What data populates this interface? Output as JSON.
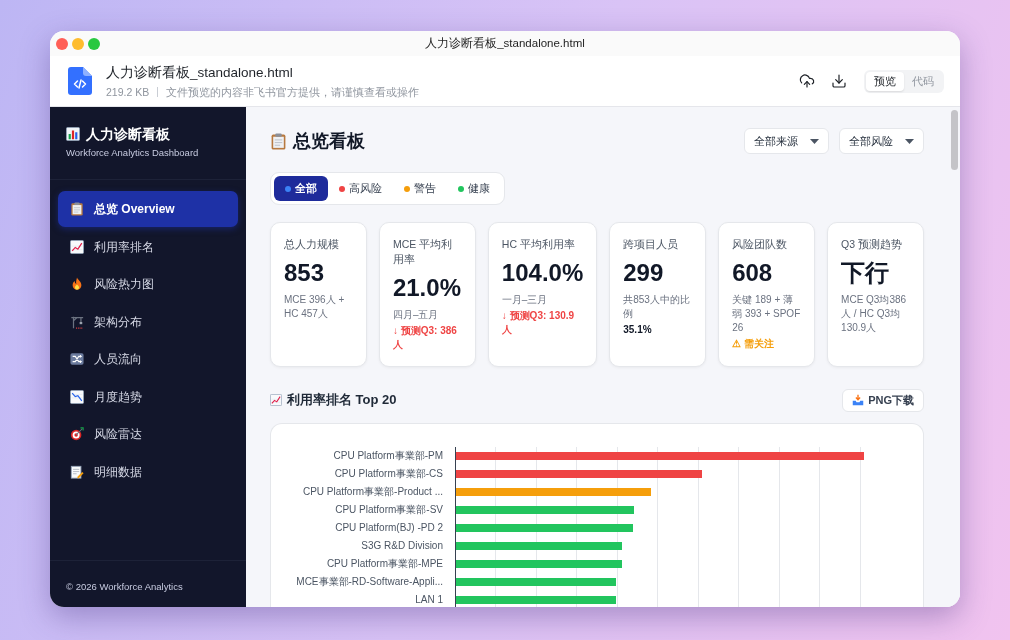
{
  "window": {
    "title": "人力诊断看板_standalone.html"
  },
  "file_header": {
    "name": "人力诊断看板_standalone.html",
    "size": "219.2 KB",
    "notice": "文件预览的内容非飞书官方提供，请谨慎查看或操作",
    "view_tabs": [
      {
        "label": "预览",
        "selected": true
      },
      {
        "label": "代码",
        "selected": false
      }
    ]
  },
  "sidebar": {
    "title": "人力诊断看板",
    "subtitle": "Workforce Analytics Dashboard",
    "items": [
      {
        "label": "总览 Overview",
        "selected": true
      },
      {
        "label": "利用率排名",
        "selected": false
      },
      {
        "label": "风险热力图",
        "selected": false
      },
      {
        "label": "架构分布",
        "selected": false
      },
      {
        "label": "人员流向",
        "selected": false
      },
      {
        "label": "月度趋势",
        "selected": false
      },
      {
        "label": "风险雷达",
        "selected": false
      },
      {
        "label": "明细数据",
        "selected": false
      }
    ],
    "footer": "© 2026 Workforce Analytics"
  },
  "main": {
    "title": "总览看板",
    "filters": [
      {
        "value": "全部来源"
      },
      {
        "value": "全部风险"
      }
    ],
    "risk_tabs": [
      {
        "label": "全部",
        "selected": true,
        "color": "#3b82f6"
      },
      {
        "label": "高风险",
        "selected": false,
        "color": "#ef4444"
      },
      {
        "label": "警告",
        "selected": false,
        "color": "#f59e0b"
      },
      {
        "label": "健康",
        "selected": false,
        "color": "#22c55e"
      }
    ],
    "cards": [
      {
        "title": "总人力规模",
        "value": "853",
        "lines": [
          {
            "kind": "note",
            "text": "MCE 396人 + HC 457人"
          }
        ]
      },
      {
        "title": "MCE 平均利用率",
        "value": "21.0%",
        "lines": [
          {
            "kind": "note",
            "text": "四月–五月"
          },
          {
            "kind": "trend",
            "text": "↓ 预测Q3: 386人"
          }
        ]
      },
      {
        "title": "HC 平均利用率",
        "value": "104.0%",
        "lines": [
          {
            "kind": "note",
            "text": "一月–三月"
          },
          {
            "kind": "trend",
            "text": "↓ 预测Q3: 130.9人"
          }
        ]
      },
      {
        "title": "跨项目人员",
        "value": "299",
        "lines": [
          {
            "kind": "note",
            "text": "共853人中的比例"
          },
          {
            "kind": "figure",
            "text": "35.1%"
          }
        ]
      },
      {
        "title": "风险团队数",
        "value": "608",
        "lines": [
          {
            "kind": "note",
            "text": "关键 189 + 薄弱 393 + SPOF 26"
          },
          {
            "kind": "alert",
            "text": "⚠ 需关注"
          }
        ]
      },
      {
        "title": "Q3 预测趋势",
        "value": "下行",
        "lines": [
          {
            "kind": "note",
            "text": "MCE Q3均386人 / HC Q3均130.9人"
          }
        ]
      }
    ],
    "ranking": {
      "title": "利用率排名 Top 20",
      "download_button": "PNG下载",
      "bars": [
        {
          "label": "CPU Platform事業部-PM",
          "color": "#ef4444",
          "level": 0.92
        },
        {
          "label": "CPU Platform事業部-CS",
          "color": "#ef4444",
          "level": 0.555
        },
        {
          "label": "CPU Platform事業部-Product ...",
          "color": "#f59e0b",
          "level": 0.44
        },
        {
          "label": "CPU Platform事業部-SV",
          "color": "#22c55e",
          "level": 0.402
        },
        {
          "label": "CPU Platform(BJ) -PD 2",
          "color": "#22c55e",
          "level": 0.398
        },
        {
          "label": "S3G R&D Division",
          "color": "#22c55e",
          "level": 0.374
        },
        {
          "label": "CPU Platform事業部-MPE",
          "color": "#22c55e",
          "level": 0.373
        },
        {
          "label": "MCE事業部-RD-Software-Appli...",
          "color": "#22c55e",
          "level": 0.36
        },
        {
          "label": "LAN 1",
          "color": "#22c55e",
          "level": 0.36
        }
      ]
    }
  }
}
